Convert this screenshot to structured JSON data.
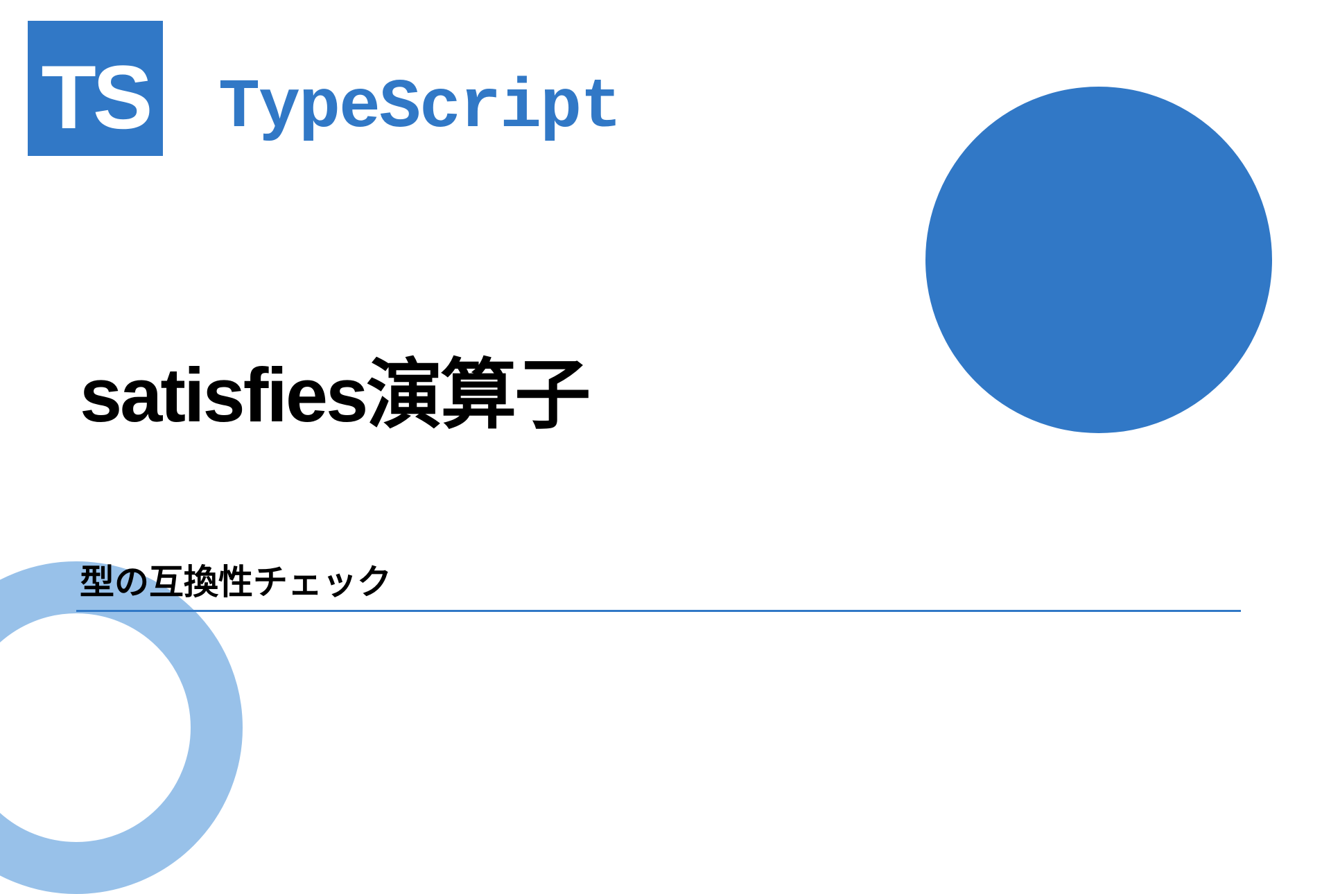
{
  "logo": {
    "text": "TS"
  },
  "header": {
    "language_name": "TypeScript"
  },
  "content": {
    "main_title": "satisfies演算子",
    "subtitle": "型の互換性チェック"
  },
  "colors": {
    "primary": "#3178c6",
    "ring": "#6ca6e0"
  }
}
